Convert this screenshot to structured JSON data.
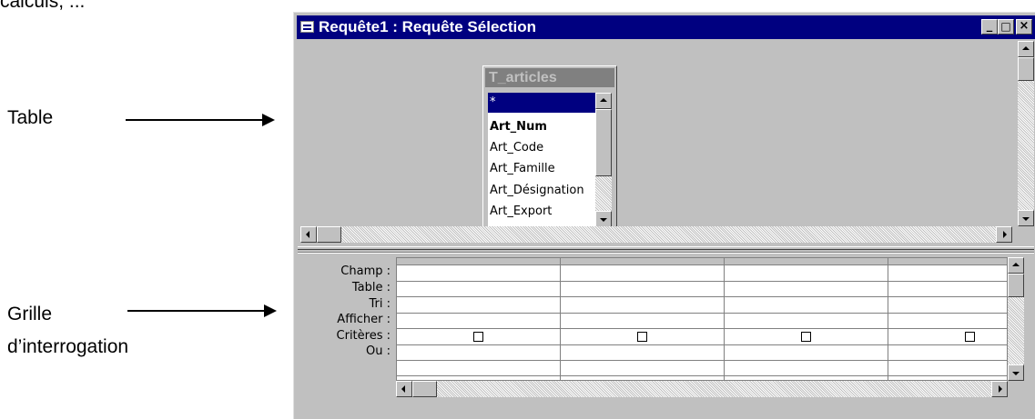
{
  "doc": {
    "top_fragment": "calculs, ...",
    "label_table": "Table",
    "label_grille_1": "Grille",
    "label_grille_2": "d’interrogation"
  },
  "window": {
    "title": "Requête1 : Requête Sélection",
    "minimize": "_",
    "maximize": "□",
    "close": "×"
  },
  "table_box": {
    "name": "T_articles",
    "fields": [
      "*",
      "Art_Num",
      "Art_Code",
      "Art_Famille",
      "Art_Désignation",
      "Art_Export"
    ],
    "selected_field": "*",
    "bold_field": "Art_Num"
  },
  "query_grid": {
    "row_labels": [
      "Champ :",
      "Table :",
      "Tri :",
      "Afficher :",
      "Critères :",
      "Ou :"
    ],
    "column_count": 4,
    "show_checked": [
      false,
      false,
      false,
      false
    ]
  },
  "colors": {
    "title_active": "#000080",
    "face": "#c0c0c0",
    "table_title_inactive": "#808080"
  }
}
